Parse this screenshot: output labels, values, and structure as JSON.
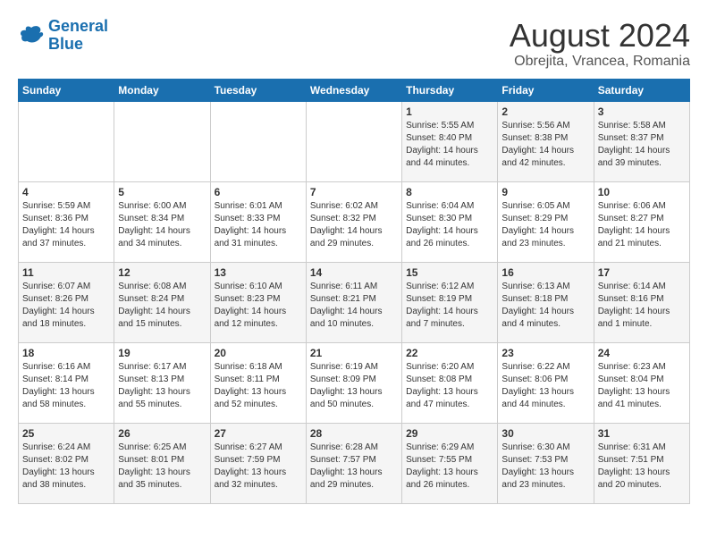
{
  "logo": {
    "line1": "General",
    "line2": "Blue"
  },
  "title": "August 2024",
  "location": "Obrejita, Vrancea, Romania",
  "days_of_week": [
    "Sunday",
    "Monday",
    "Tuesday",
    "Wednesday",
    "Thursday",
    "Friday",
    "Saturday"
  ],
  "weeks": [
    [
      {
        "day": "",
        "info": ""
      },
      {
        "day": "",
        "info": ""
      },
      {
        "day": "",
        "info": ""
      },
      {
        "day": "",
        "info": ""
      },
      {
        "day": "1",
        "info": "Sunrise: 5:55 AM\nSunset: 8:40 PM\nDaylight: 14 hours\nand 44 minutes."
      },
      {
        "day": "2",
        "info": "Sunrise: 5:56 AM\nSunset: 8:38 PM\nDaylight: 14 hours\nand 42 minutes."
      },
      {
        "day": "3",
        "info": "Sunrise: 5:58 AM\nSunset: 8:37 PM\nDaylight: 14 hours\nand 39 minutes."
      }
    ],
    [
      {
        "day": "4",
        "info": "Sunrise: 5:59 AM\nSunset: 8:36 PM\nDaylight: 14 hours\nand 37 minutes."
      },
      {
        "day": "5",
        "info": "Sunrise: 6:00 AM\nSunset: 8:34 PM\nDaylight: 14 hours\nand 34 minutes."
      },
      {
        "day": "6",
        "info": "Sunrise: 6:01 AM\nSunset: 8:33 PM\nDaylight: 14 hours\nand 31 minutes."
      },
      {
        "day": "7",
        "info": "Sunrise: 6:02 AM\nSunset: 8:32 PM\nDaylight: 14 hours\nand 29 minutes."
      },
      {
        "day": "8",
        "info": "Sunrise: 6:04 AM\nSunset: 8:30 PM\nDaylight: 14 hours\nand 26 minutes."
      },
      {
        "day": "9",
        "info": "Sunrise: 6:05 AM\nSunset: 8:29 PM\nDaylight: 14 hours\nand 23 minutes."
      },
      {
        "day": "10",
        "info": "Sunrise: 6:06 AM\nSunset: 8:27 PM\nDaylight: 14 hours\nand 21 minutes."
      }
    ],
    [
      {
        "day": "11",
        "info": "Sunrise: 6:07 AM\nSunset: 8:26 PM\nDaylight: 14 hours\nand 18 minutes."
      },
      {
        "day": "12",
        "info": "Sunrise: 6:08 AM\nSunset: 8:24 PM\nDaylight: 14 hours\nand 15 minutes."
      },
      {
        "day": "13",
        "info": "Sunrise: 6:10 AM\nSunset: 8:23 PM\nDaylight: 14 hours\nand 12 minutes."
      },
      {
        "day": "14",
        "info": "Sunrise: 6:11 AM\nSunset: 8:21 PM\nDaylight: 14 hours\nand 10 minutes."
      },
      {
        "day": "15",
        "info": "Sunrise: 6:12 AM\nSunset: 8:19 PM\nDaylight: 14 hours\nand 7 minutes."
      },
      {
        "day": "16",
        "info": "Sunrise: 6:13 AM\nSunset: 8:18 PM\nDaylight: 14 hours\nand 4 minutes."
      },
      {
        "day": "17",
        "info": "Sunrise: 6:14 AM\nSunset: 8:16 PM\nDaylight: 14 hours\nand 1 minute."
      }
    ],
    [
      {
        "day": "18",
        "info": "Sunrise: 6:16 AM\nSunset: 8:14 PM\nDaylight: 13 hours\nand 58 minutes."
      },
      {
        "day": "19",
        "info": "Sunrise: 6:17 AM\nSunset: 8:13 PM\nDaylight: 13 hours\nand 55 minutes."
      },
      {
        "day": "20",
        "info": "Sunrise: 6:18 AM\nSunset: 8:11 PM\nDaylight: 13 hours\nand 52 minutes."
      },
      {
        "day": "21",
        "info": "Sunrise: 6:19 AM\nSunset: 8:09 PM\nDaylight: 13 hours\nand 50 minutes."
      },
      {
        "day": "22",
        "info": "Sunrise: 6:20 AM\nSunset: 8:08 PM\nDaylight: 13 hours\nand 47 minutes."
      },
      {
        "day": "23",
        "info": "Sunrise: 6:22 AM\nSunset: 8:06 PM\nDaylight: 13 hours\nand 44 minutes."
      },
      {
        "day": "24",
        "info": "Sunrise: 6:23 AM\nSunset: 8:04 PM\nDaylight: 13 hours\nand 41 minutes."
      }
    ],
    [
      {
        "day": "25",
        "info": "Sunrise: 6:24 AM\nSunset: 8:02 PM\nDaylight: 13 hours\nand 38 minutes."
      },
      {
        "day": "26",
        "info": "Sunrise: 6:25 AM\nSunset: 8:01 PM\nDaylight: 13 hours\nand 35 minutes."
      },
      {
        "day": "27",
        "info": "Sunrise: 6:27 AM\nSunset: 7:59 PM\nDaylight: 13 hours\nand 32 minutes."
      },
      {
        "day": "28",
        "info": "Sunrise: 6:28 AM\nSunset: 7:57 PM\nDaylight: 13 hours\nand 29 minutes."
      },
      {
        "day": "29",
        "info": "Sunrise: 6:29 AM\nSunset: 7:55 PM\nDaylight: 13 hours\nand 26 minutes."
      },
      {
        "day": "30",
        "info": "Sunrise: 6:30 AM\nSunset: 7:53 PM\nDaylight: 13 hours\nand 23 minutes."
      },
      {
        "day": "31",
        "info": "Sunrise: 6:31 AM\nSunset: 7:51 PM\nDaylight: 13 hours\nand 20 minutes."
      }
    ]
  ]
}
